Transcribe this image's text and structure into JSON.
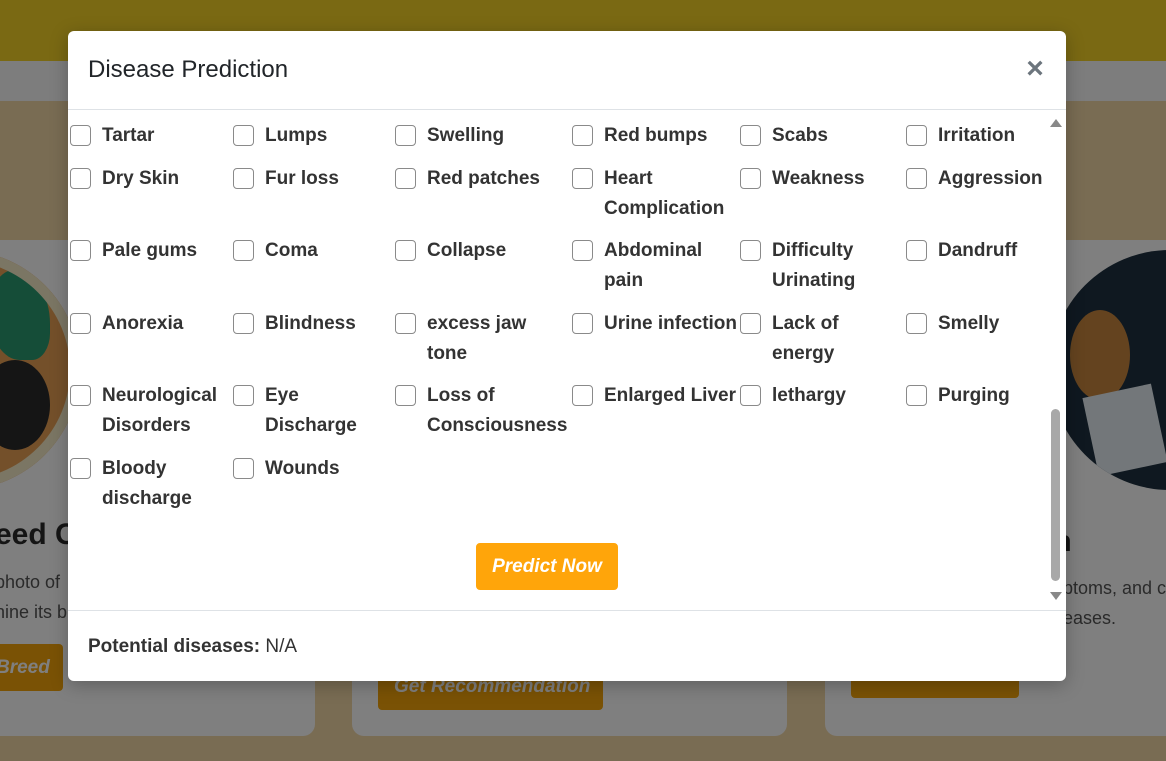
{
  "background": {
    "left_title": "eed C",
    "left_line1": "photo of",
    "left_line2": "nine its b",
    "left_button": "Breed",
    "mid_button": "Get Recommendation",
    "right_title": "on",
    "right_line1": "ptoms, and c",
    "right_line2": "eases."
  },
  "modal": {
    "title": "Disease Prediction",
    "close_label": "×",
    "symptoms": [
      "Tartar",
      "Lumps",
      "Swelling",
      "Red bumps",
      "Scabs",
      "Irritation",
      "Dry Skin",
      "Fur loss",
      "Red patches",
      "Heart Complication",
      "Weakness",
      "Aggression",
      "Pale gums",
      "Coma",
      "Collapse",
      "Abdominal pain",
      "Difficulty Urinating",
      "Dandruff",
      "Anorexia",
      "Blindness",
      "excess jaw tone",
      "Urine infection",
      "Lack of energy",
      "Smelly",
      "Neurological Disorders",
      "Eye Discharge",
      "Loss of Consciousness",
      "Enlarged Liver",
      "lethargy",
      "Purging",
      "Bloody discharge",
      "Wounds"
    ],
    "predict_button": "Predict Now",
    "result_label": "Potential diseases:",
    "result_value": "N/A"
  }
}
